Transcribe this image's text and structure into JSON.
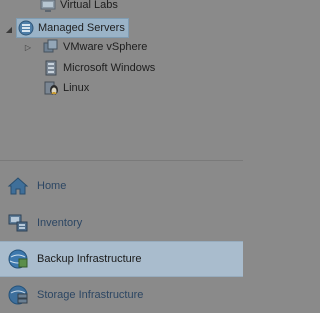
{
  "tree": {
    "items": [
      {
        "label": "Virtual Labs",
        "icon": "virtual-labs-icon"
      },
      {
        "label": "Managed Servers",
        "icon": "managed-servers-icon",
        "expanded": true,
        "selected": true
      },
      {
        "label": "VMware vSphere",
        "icon": "vmware-vsphere-icon",
        "collapsed": true
      },
      {
        "label": "Microsoft Windows",
        "icon": "microsoft-windows-icon"
      },
      {
        "label": "Linux",
        "icon": "linux-icon"
      }
    ]
  },
  "nav": {
    "items": [
      {
        "label": "Home",
        "icon": "home-icon"
      },
      {
        "label": "Inventory",
        "icon": "inventory-icon"
      },
      {
        "label": "Backup Infrastructure",
        "icon": "backup-infrastructure-icon",
        "active": true
      },
      {
        "label": "Storage Infrastructure",
        "icon": "storage-infrastructure-icon"
      }
    ]
  },
  "colors": {
    "background": "#8a8a8a",
    "selection": "#9ab3c7",
    "nav_active": "#a9bccd",
    "nav_text": "#2c4663"
  }
}
